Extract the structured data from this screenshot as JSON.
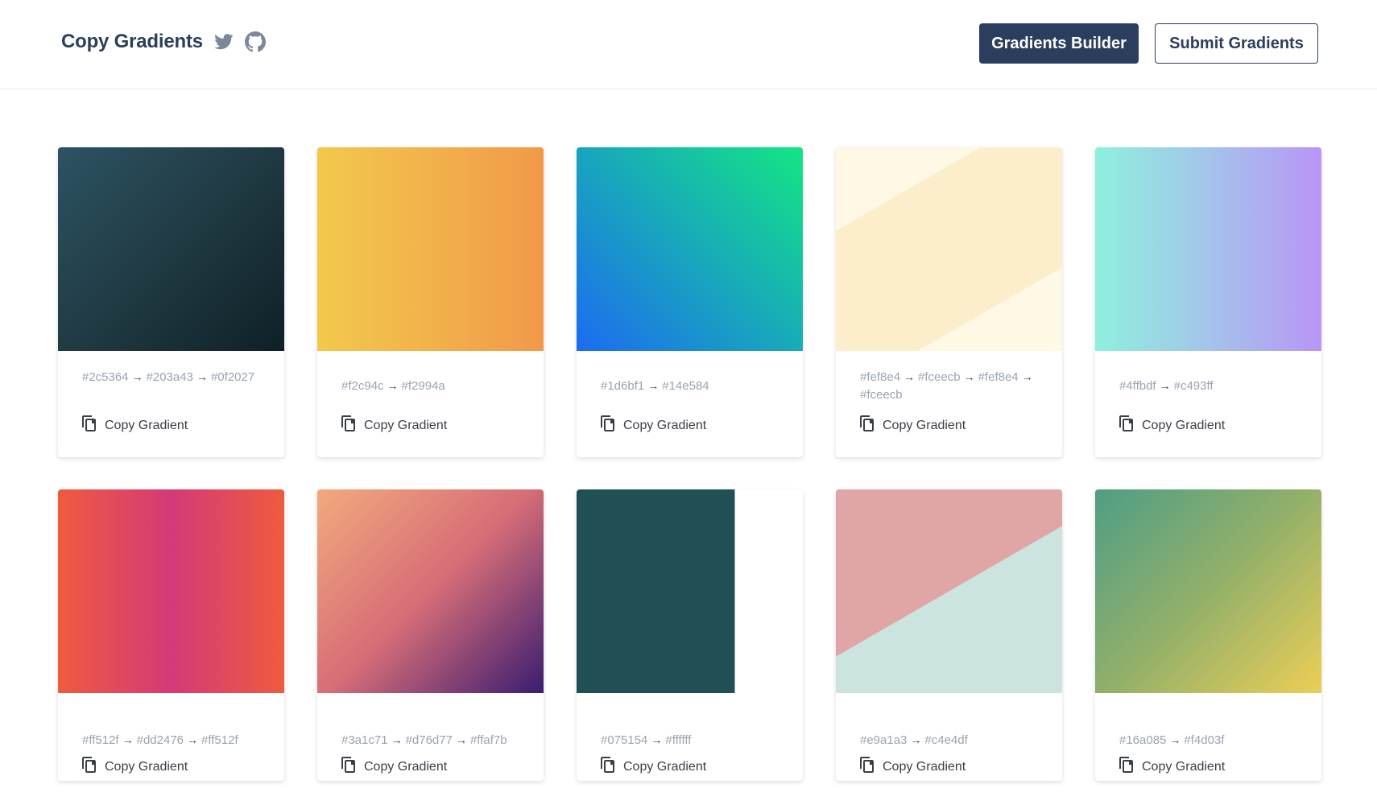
{
  "header": {
    "title": "Copy Gradients",
    "twitter_icon": "twitter-icon",
    "github_icon": "github-icon",
    "builder_label": "Gradients Builder",
    "submit_label": "Submit Gradients",
    "brand_color": "#2c3e5d"
  },
  "copy_label": "Copy Gradient",
  "cards": [
    {
      "colors": [
        "#2c5364",
        "#203a43",
        "#0f2027"
      ],
      "style": "linear-gradient(135deg, #2c5364 0%, #203a43 50%, #0f2027 100%)"
    },
    {
      "colors": [
        "#f2c94c",
        "#f2994a"
      ],
      "style": "linear-gradient(90deg, #f2c94c 0%, #f2994a 100%)"
    },
    {
      "colors": [
        "#1d6bf1",
        "#14e584"
      ],
      "style": "linear-gradient(45deg, #1d6bf1 0%, #14e584 100%)"
    },
    {
      "colors": [
        "#fef8e4",
        "#fceecb",
        "#fef8e4",
        "#fceecb"
      ],
      "style": "linear-gradient(150deg, #fef8e4 0%, #fef8e4 25%, #fceecb 25%, #fceecb 75%, #fef8e4 75%, #fef8e4 100%)"
    },
    {
      "colors": [
        "#4ffbdf",
        "#c493ff"
      ],
      "style": "linear-gradient(90deg, #8ef0dd 0%, #a4c4ea 50%, #b995f7 100%)"
    },
    {
      "colors": [
        "#ff512f",
        "#dd2476",
        "#ff512f"
      ],
      "style": "linear-gradient(90deg, #ef5b3e 0%, #d33a78 50%, #ef5b3e 100%)"
    },
    {
      "colors": [
        "#3a1c71",
        "#d76d77",
        "#ffaf7b"
      ],
      "style": "linear-gradient(315deg, #3a1c71 0%, #d76d77 50%, #f2aa7d 100%)"
    },
    {
      "colors": [
        "#075154",
        "#ffffff"
      ],
      "style": "linear-gradient(90deg, #205055 0%, #205055 70%, #ffffff 70%, #ffffff 100%)"
    },
    {
      "colors": [
        "#e9a1a3",
        "#c4e4df"
      ],
      "style": "linear-gradient(150deg, #e0a5a5 0%, #e0a5a5 50%, #cce4df 50%, #cce4df 100%)"
    },
    {
      "colors": [
        "#16a085",
        "#f4d03f"
      ],
      "style": "linear-gradient(135deg, #4f9d85 0%, #92b06a 50%, #ecce56 100%)"
    }
  ]
}
